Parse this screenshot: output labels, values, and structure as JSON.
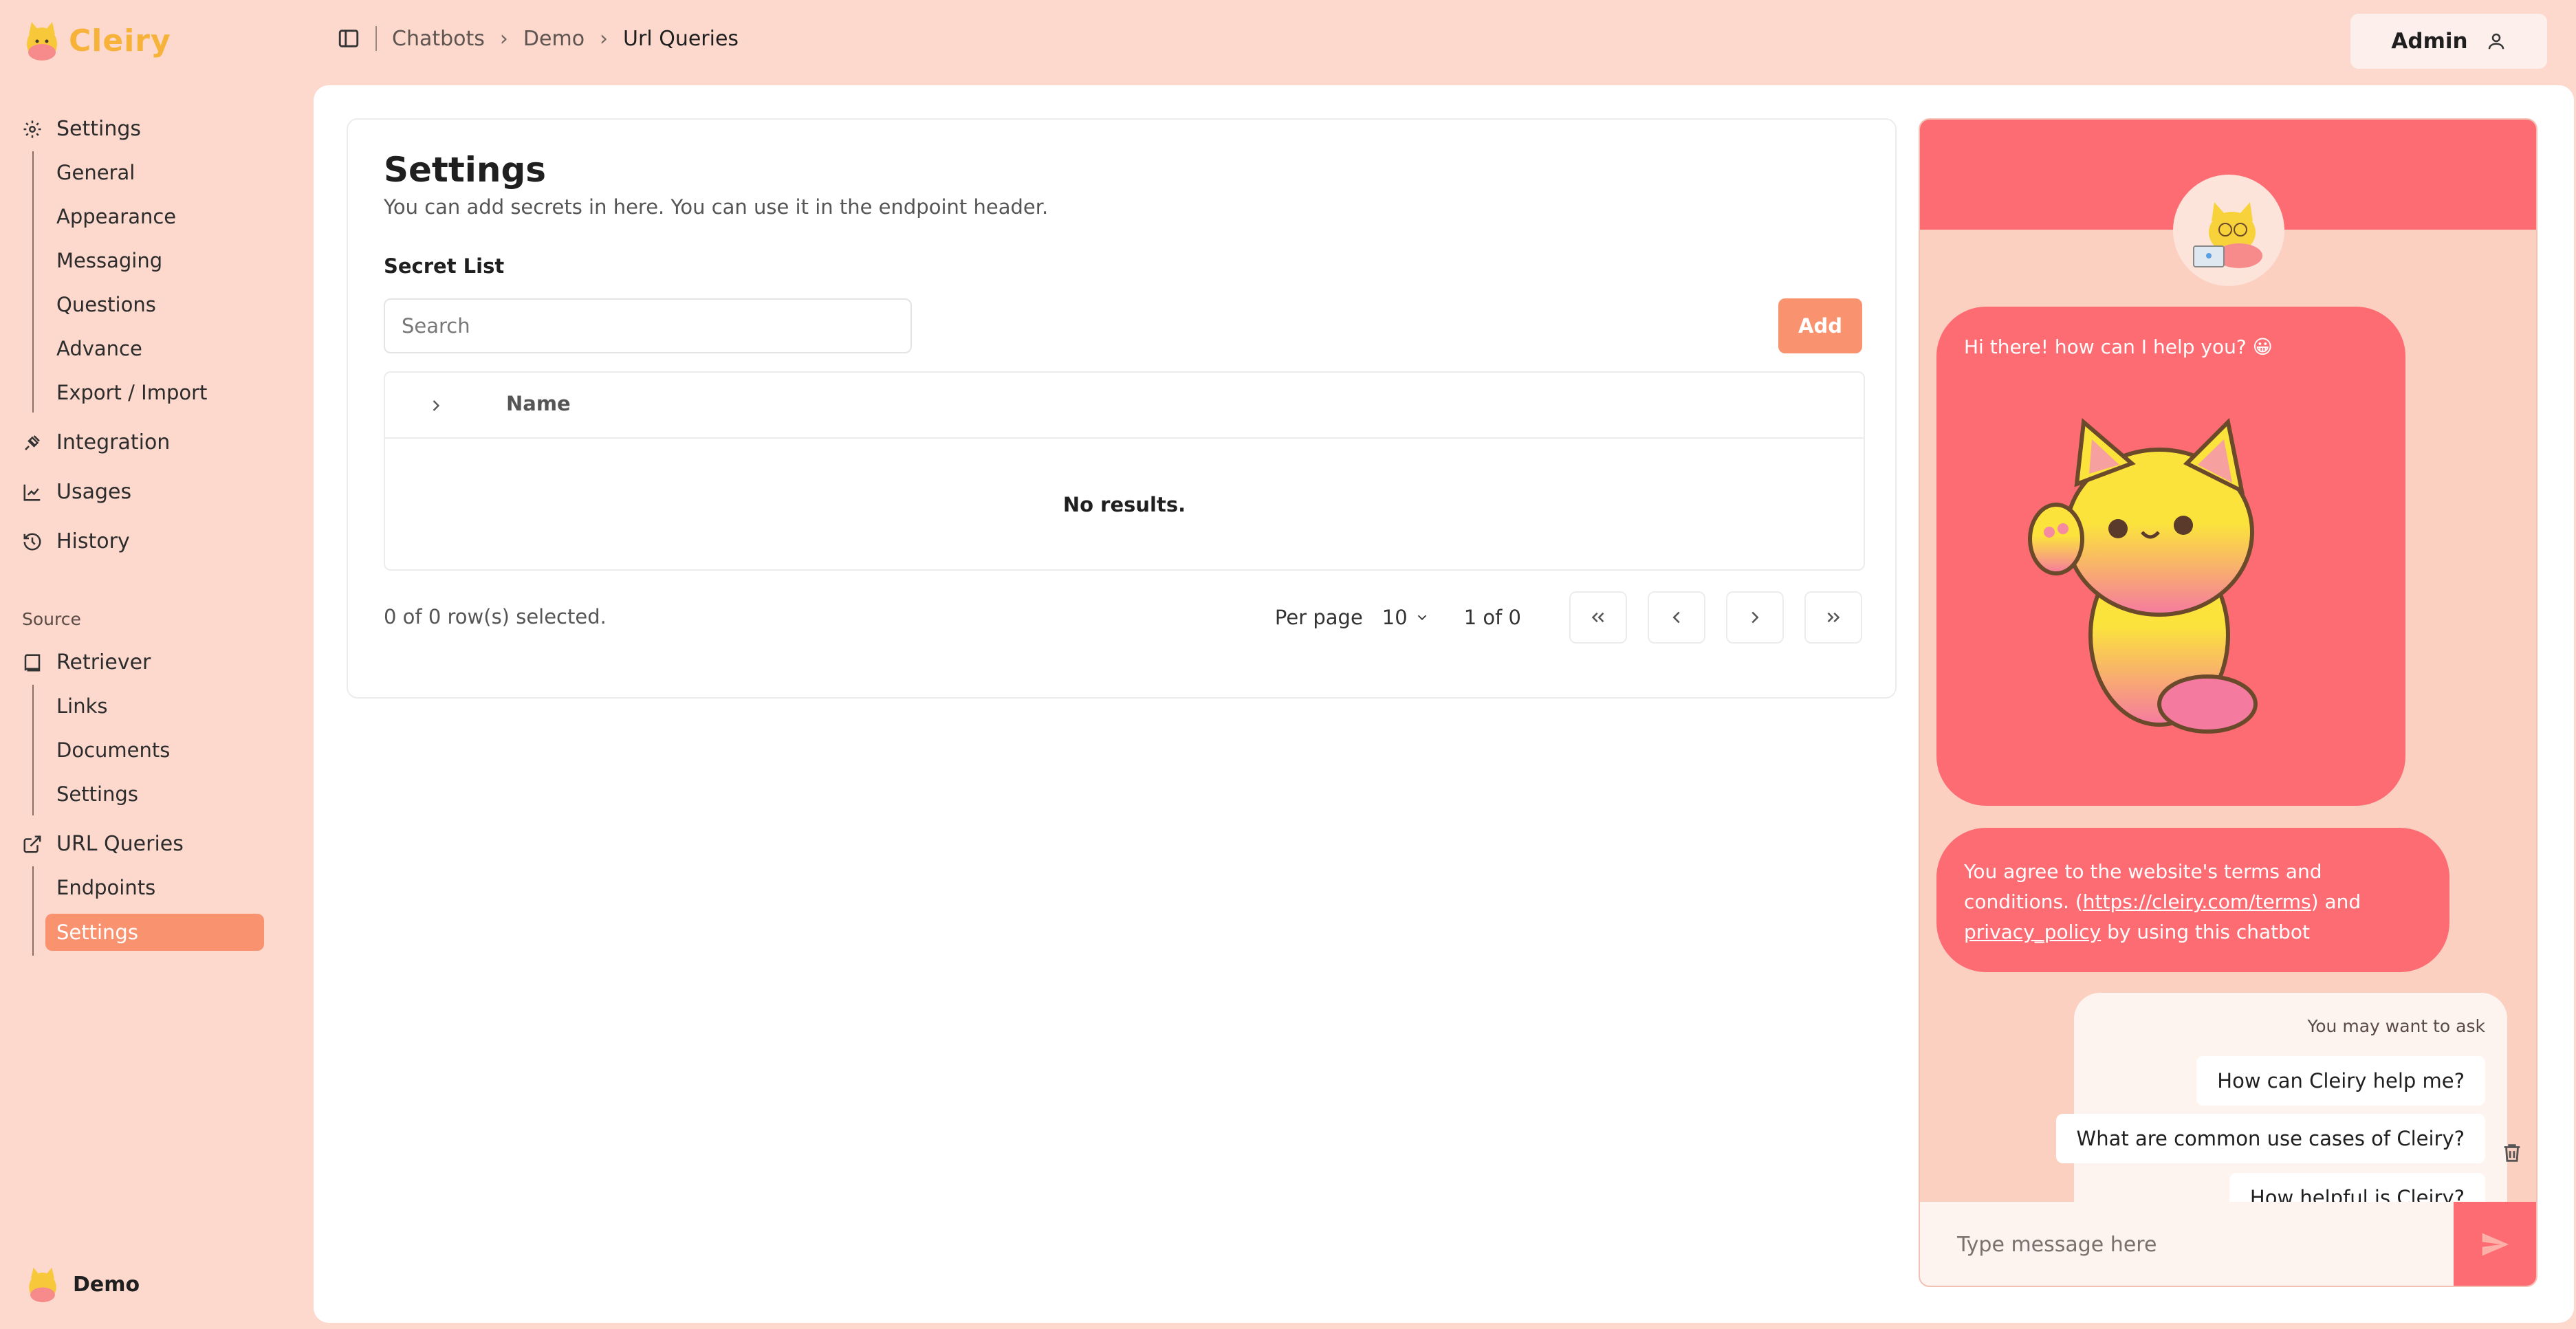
{
  "brand": {
    "name": "Cleiry",
    "color": "#f7b23a"
  },
  "topbar": {
    "crumbs": [
      "Chatbots",
      "Demo",
      "Url Queries"
    ],
    "user_label": "Admin"
  },
  "sidebar": {
    "settings": {
      "label": "Settings",
      "items": [
        "General",
        "Appearance",
        "Messaging",
        "Questions",
        "Advance",
        "Export / Import"
      ]
    },
    "integration": "Integration",
    "usages": "Usages",
    "history": "History",
    "source_label": "Source",
    "retriever": {
      "label": "Retriever",
      "items": [
        "Links",
        "Documents",
        "Settings"
      ]
    },
    "url_queries": {
      "label": "URL Queries",
      "items": [
        "Endpoints",
        "Settings"
      ],
      "active_index": 1
    },
    "footer_user": "Demo"
  },
  "main": {
    "title": "Settings",
    "description": "You can add secrets in here. You can use it in the endpoint header.",
    "list_title": "Secret List",
    "search_placeholder": "Search",
    "add_label": "Add",
    "column_name": "Name",
    "empty_text": "No results.",
    "selected_text": "0 of 0 row(s) selected.",
    "per_page_label": "Per page",
    "per_page_value": "10",
    "page_of": "1 of 0"
  },
  "chat": {
    "greeting": "Hi there! how can I help you? 😀",
    "terms_part1": "You agree to the website's terms and conditions. (",
    "terms_link": "https://cleiry.com/terms",
    "terms_part2": ") and ",
    "privacy_link": "privacy_policy",
    "terms_part3": " by using this chatbot",
    "suggest_hint": "You may want to ask",
    "suggestions": [
      "How can Cleiry help me?",
      "What are common use cases of Cleiry?",
      "How helpful is Cleiry?"
    ],
    "input_placeholder": "Type message here",
    "accent": "#fd6c72"
  },
  "colors": {
    "background": "#fcd8cd",
    "active": "#f9926f"
  }
}
